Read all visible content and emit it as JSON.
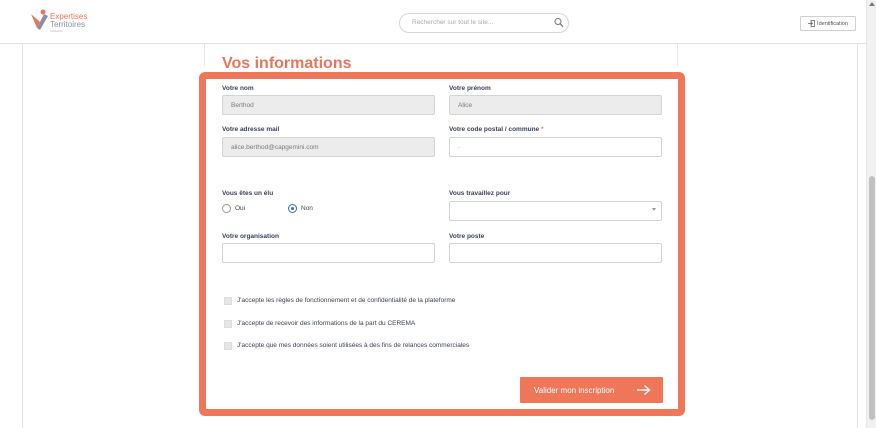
{
  "header": {
    "logo_line1": "Expertises",
    "logo_line2": "Territoires",
    "logo_line3": "CEREMA",
    "search_placeholder": "Rechercher sur tout le site...",
    "login_label": "Identification"
  },
  "form": {
    "title": "Vos informations",
    "nom_label": "Votre nom",
    "nom_value": "Berthod",
    "prenom_label": "Votre prénom",
    "prenom_value": "Alice",
    "email_label": "Votre adresse mail",
    "email_value": "alice.berthod@capgemini.com",
    "code_postal_label": "Votre code postal / commune",
    "code_postal_required": "*",
    "code_postal_value": "-",
    "elu_label": "Vous êtes un élu",
    "elu_options": [
      "Oui",
      "Non"
    ],
    "elu_selected": "Non",
    "travaillez_label": "Vous travaillez pour",
    "travaillez_value": "",
    "organisation_label": "Votre organisation",
    "organisation_value": "",
    "poste_label": "Votre poste",
    "poste_value": "",
    "checkboxes": [
      "J'accepte les règles de fonctionnement et de confidentialité de la plateforme",
      "J'accepte de recevoir des informations de la part du CEREMA",
      "J'accepte que mes données soient utilisées à des fins de relances commerciales"
    ],
    "submit_label": "Valider mon inscription"
  },
  "colors": {
    "accent": "#ee7659",
    "label": "#3a3f5c",
    "radio_checked": "#2f6fd6"
  }
}
